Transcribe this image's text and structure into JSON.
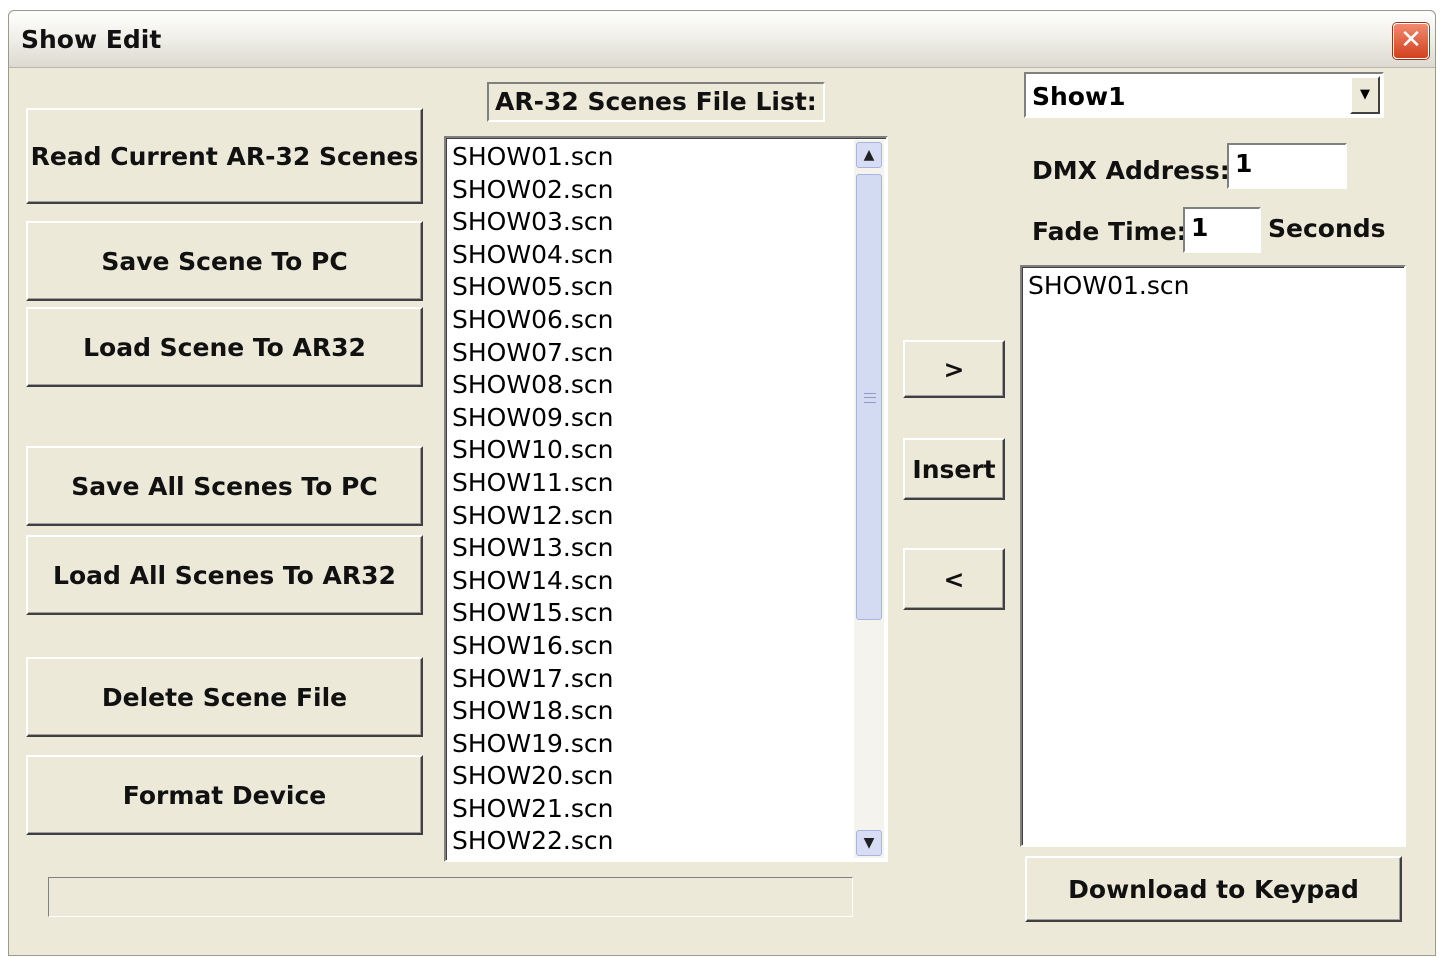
{
  "window": {
    "title": "Show Edit",
    "close_symbol": "✕"
  },
  "left_buttons": {
    "read_current": "Read Current AR-32 Scenes",
    "save_scene_to_pc": "Save Scene To PC",
    "load_scene_to_ar32": "Load Scene To AR32",
    "save_all_scenes_to_pc": "Save All Scenes To PC",
    "load_all_scenes_to_ar32": "Load All Scenes To AR32",
    "delete_scene_file": "Delete Scene File",
    "format_device": "Format Device"
  },
  "file_list": {
    "label": "AR-32 Scenes File List:",
    "items": [
      "SHOW01.scn",
      "SHOW02.scn",
      "SHOW03.scn",
      "SHOW04.scn",
      "SHOW05.scn",
      "SHOW06.scn",
      "SHOW07.scn",
      "SHOW08.scn",
      "SHOW09.scn",
      "SHOW10.scn",
      "SHOW11.scn",
      "SHOW12.scn",
      "SHOW13.scn",
      "SHOW14.scn",
      "SHOW15.scn",
      "SHOW16.scn",
      "SHOW17.scn",
      "SHOW18.scn",
      "SHOW19.scn",
      "SHOW20.scn",
      "SHOW21.scn",
      "SHOW22.scn"
    ],
    "scroll_up_icon": "chevron-up-icon",
    "scroll_down_icon": "chevron-down-icon"
  },
  "middle_buttons": {
    "add": ">",
    "insert": "Insert",
    "remove": "<"
  },
  "show": {
    "selected": "Show1",
    "dropdown_icon": "caret-down-icon",
    "dmx_label": "DMX Address:",
    "dmx_value": "1",
    "fade_label": "Fade Time:",
    "fade_value": "1",
    "fade_unit": "Seconds",
    "items": [
      "SHOW01.scn"
    ]
  },
  "download_button": "Download to Keypad",
  "progress": {
    "value": 0
  }
}
